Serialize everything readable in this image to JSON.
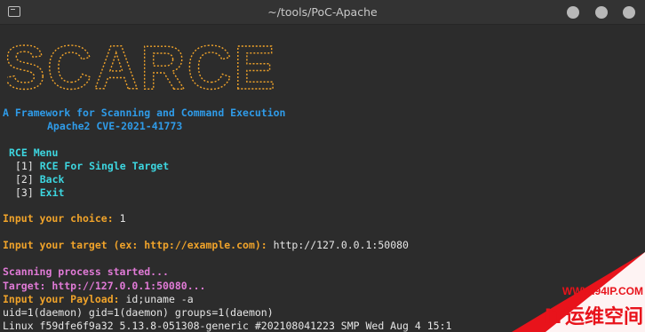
{
  "window": {
    "title": "~/tools/PoC-Apache"
  },
  "banner": {
    "logo_text": "SCARCE",
    "subtitle": "A Framework for Scanning and Command Execution",
    "cve": "Apache2 CVE-2021-41773"
  },
  "menu": {
    "title": "RCE Menu",
    "items": [
      {
        "index": "[1]",
        "label": "RCE For Single Target"
      },
      {
        "index": "[2]",
        "label": "Back"
      },
      {
        "index": "[3]",
        "label": "Exit"
      }
    ]
  },
  "prompts": {
    "choice_label": "Input your choice:",
    "choice_value": "1",
    "target_label": "Input your target (ex: http://example.com):",
    "target_value": "http://127.0.0.1:50080"
  },
  "scan": {
    "started": "Scanning process started...",
    "target_line": "Target: http://127.0.0.1:50080...",
    "payload_label": "Input your Payload:",
    "payload_value": "id;uname -a",
    "output": [
      "uid=1(daemon) gid=1(daemon) groups=1(daemon)",
      "Linux f59dfe6f9a32 5.13.8-051308-generic #202108041223 SMP Wed Aug 4 15:1"
    ]
  },
  "watermark": {
    "url": "WWW.94IP.COM",
    "brand": "IT运维空间"
  },
  "colors": {
    "background": "#2c2c2c",
    "logo_orange": "#f0a32a",
    "banner_blue": "#2f9be8",
    "menu_cyan": "#3dd6e0",
    "scan_pink": "#e07ad6",
    "watermark_red": "#e8131b"
  }
}
